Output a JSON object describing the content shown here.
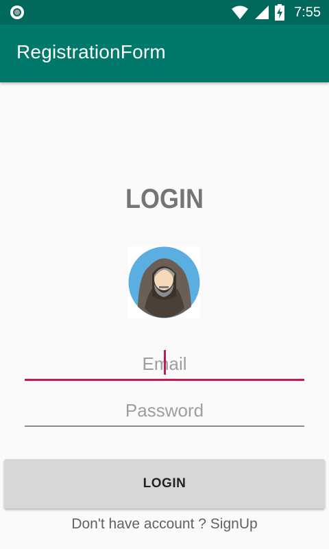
{
  "status_bar": {
    "time": "7:55",
    "icons": [
      "circle-notification-icon",
      "wifi-icon",
      "signal-icon",
      "battery-charging-icon"
    ]
  },
  "app_bar": {
    "title": "RegistrationForm"
  },
  "login_form": {
    "heading": "LOGIN",
    "avatar_icon": "hooded-man-avatar-icon",
    "email_placeholder": "Email",
    "password_placeholder": "Password",
    "login_button_label": "LOGIN",
    "signup_text": "Don't have account ? SignUp"
  },
  "colors": {
    "status_bar": "#00695c",
    "app_bar": "#00796b",
    "accent": "#c2185b",
    "button": "#d6d7d7"
  }
}
